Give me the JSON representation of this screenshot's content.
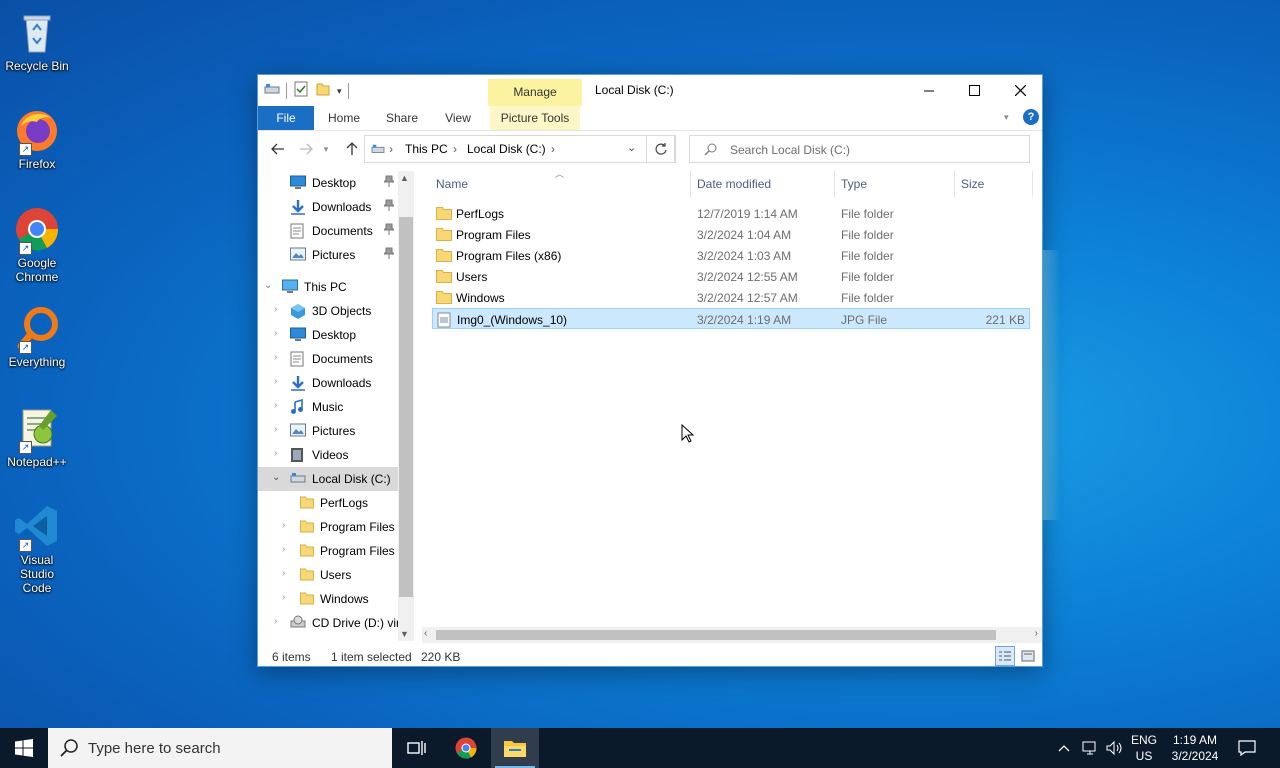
{
  "desktop": {
    "icons": [
      {
        "label": "Recycle Bin",
        "icon": "recycle-bin-icon"
      },
      {
        "label": "Firefox",
        "icon": "firefox-icon"
      },
      {
        "label": "Google Chrome",
        "icon": "chrome-icon"
      },
      {
        "label": "Everything",
        "icon": "everything-icon"
      },
      {
        "label": "Notepad++",
        "icon": "notepadpp-icon"
      },
      {
        "label": "Visual Studio Code",
        "icon": "vscode-icon"
      }
    ]
  },
  "window": {
    "title": "Local Disk (C:)",
    "manage_tab": "Manage",
    "ribbon_tabs": [
      "File",
      "Home",
      "Share",
      "View",
      "Picture Tools"
    ],
    "breadcrumb": [
      "This PC",
      "Local Disk (C:)"
    ],
    "search_placeholder": "Search Local Disk (C:)",
    "nav": {
      "quick_access": [
        {
          "label": "Desktop",
          "icon": "desktop-icon"
        },
        {
          "label": "Downloads",
          "icon": "downloads-icon"
        },
        {
          "label": "Documents",
          "icon": "documents-icon"
        },
        {
          "label": "Pictures",
          "icon": "pictures-icon"
        }
      ],
      "this_pc": "This PC",
      "this_pc_items": [
        {
          "label": "3D Objects",
          "icon": "3d-objects-icon"
        },
        {
          "label": "Desktop",
          "icon": "desktop-icon"
        },
        {
          "label": "Documents",
          "icon": "documents-icon"
        },
        {
          "label": "Downloads",
          "icon": "downloads-icon"
        },
        {
          "label": "Music",
          "icon": "music-icon"
        },
        {
          "label": "Pictures",
          "icon": "pictures-icon"
        },
        {
          "label": "Videos",
          "icon": "videos-icon"
        }
      ],
      "local_disk": "Local Disk (C:)",
      "local_disk_children": [
        "PerfLogs",
        "Program Files",
        "Program Files (",
        "Users",
        "Windows"
      ],
      "cd_drive": "CD Drive (D:) virt"
    },
    "columns": {
      "name": "Name",
      "date": "Date modified",
      "type": "Type",
      "size": "Size"
    },
    "files": [
      {
        "name": "PerfLogs",
        "date": "12/7/2019 1:14 AM",
        "type": "File folder",
        "size": ""
      },
      {
        "name": "Program Files",
        "date": "3/2/2024 1:04 AM",
        "type": "File folder",
        "size": ""
      },
      {
        "name": "Program Files (x86)",
        "date": "3/2/2024 1:03 AM",
        "type": "File folder",
        "size": ""
      },
      {
        "name": "Users",
        "date": "3/2/2024 12:55 AM",
        "type": "File folder",
        "size": ""
      },
      {
        "name": "Windows",
        "date": "3/2/2024 12:57 AM",
        "type": "File folder",
        "size": ""
      },
      {
        "name": "Img0_(Windows_10)",
        "date": "3/2/2024 1:19 AM",
        "type": "JPG File",
        "size": "221 KB"
      }
    ],
    "status": {
      "items": "6 items",
      "selected": "1 item selected",
      "size": "220 KB"
    }
  },
  "taskbar": {
    "search_placeholder": "Type here to search",
    "lang_top": "ENG",
    "lang_bottom": "US",
    "time": "1:19 AM",
    "date": "3/2/2024"
  }
}
